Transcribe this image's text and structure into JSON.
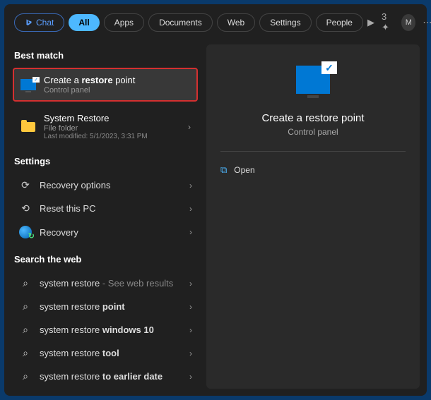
{
  "topbar": {
    "chat": "Chat",
    "tabs": [
      "All",
      "Apps",
      "Documents",
      "Web",
      "Settings",
      "People"
    ],
    "rewards": "3"
  },
  "left": {
    "best_match": "Best match",
    "result1": {
      "pre": "Create a ",
      "bold": "restore",
      "post": " point",
      "sub": "Control panel"
    },
    "result2": {
      "title": "System Restore",
      "sub": "File folder",
      "sub2": "Last modified: 5/1/2023, 3:31 PM"
    },
    "settings_h": "Settings",
    "settings_items": [
      "Recovery options",
      "Reset this PC",
      "Recovery"
    ],
    "web_h": "Search the web",
    "web_items": [
      {
        "pre": "system restore",
        "bold": "",
        "hint": " - See web results"
      },
      {
        "pre": "system restore ",
        "bold": "point",
        "hint": ""
      },
      {
        "pre": "system restore ",
        "bold": "windows 10",
        "hint": ""
      },
      {
        "pre": "system restore ",
        "bold": "tool",
        "hint": ""
      },
      {
        "pre": "system restore ",
        "bold": "to earlier date",
        "hint": ""
      }
    ]
  },
  "right": {
    "title": "Create a restore point",
    "sub": "Control panel",
    "open": "Open"
  },
  "avatar_letter": "M"
}
